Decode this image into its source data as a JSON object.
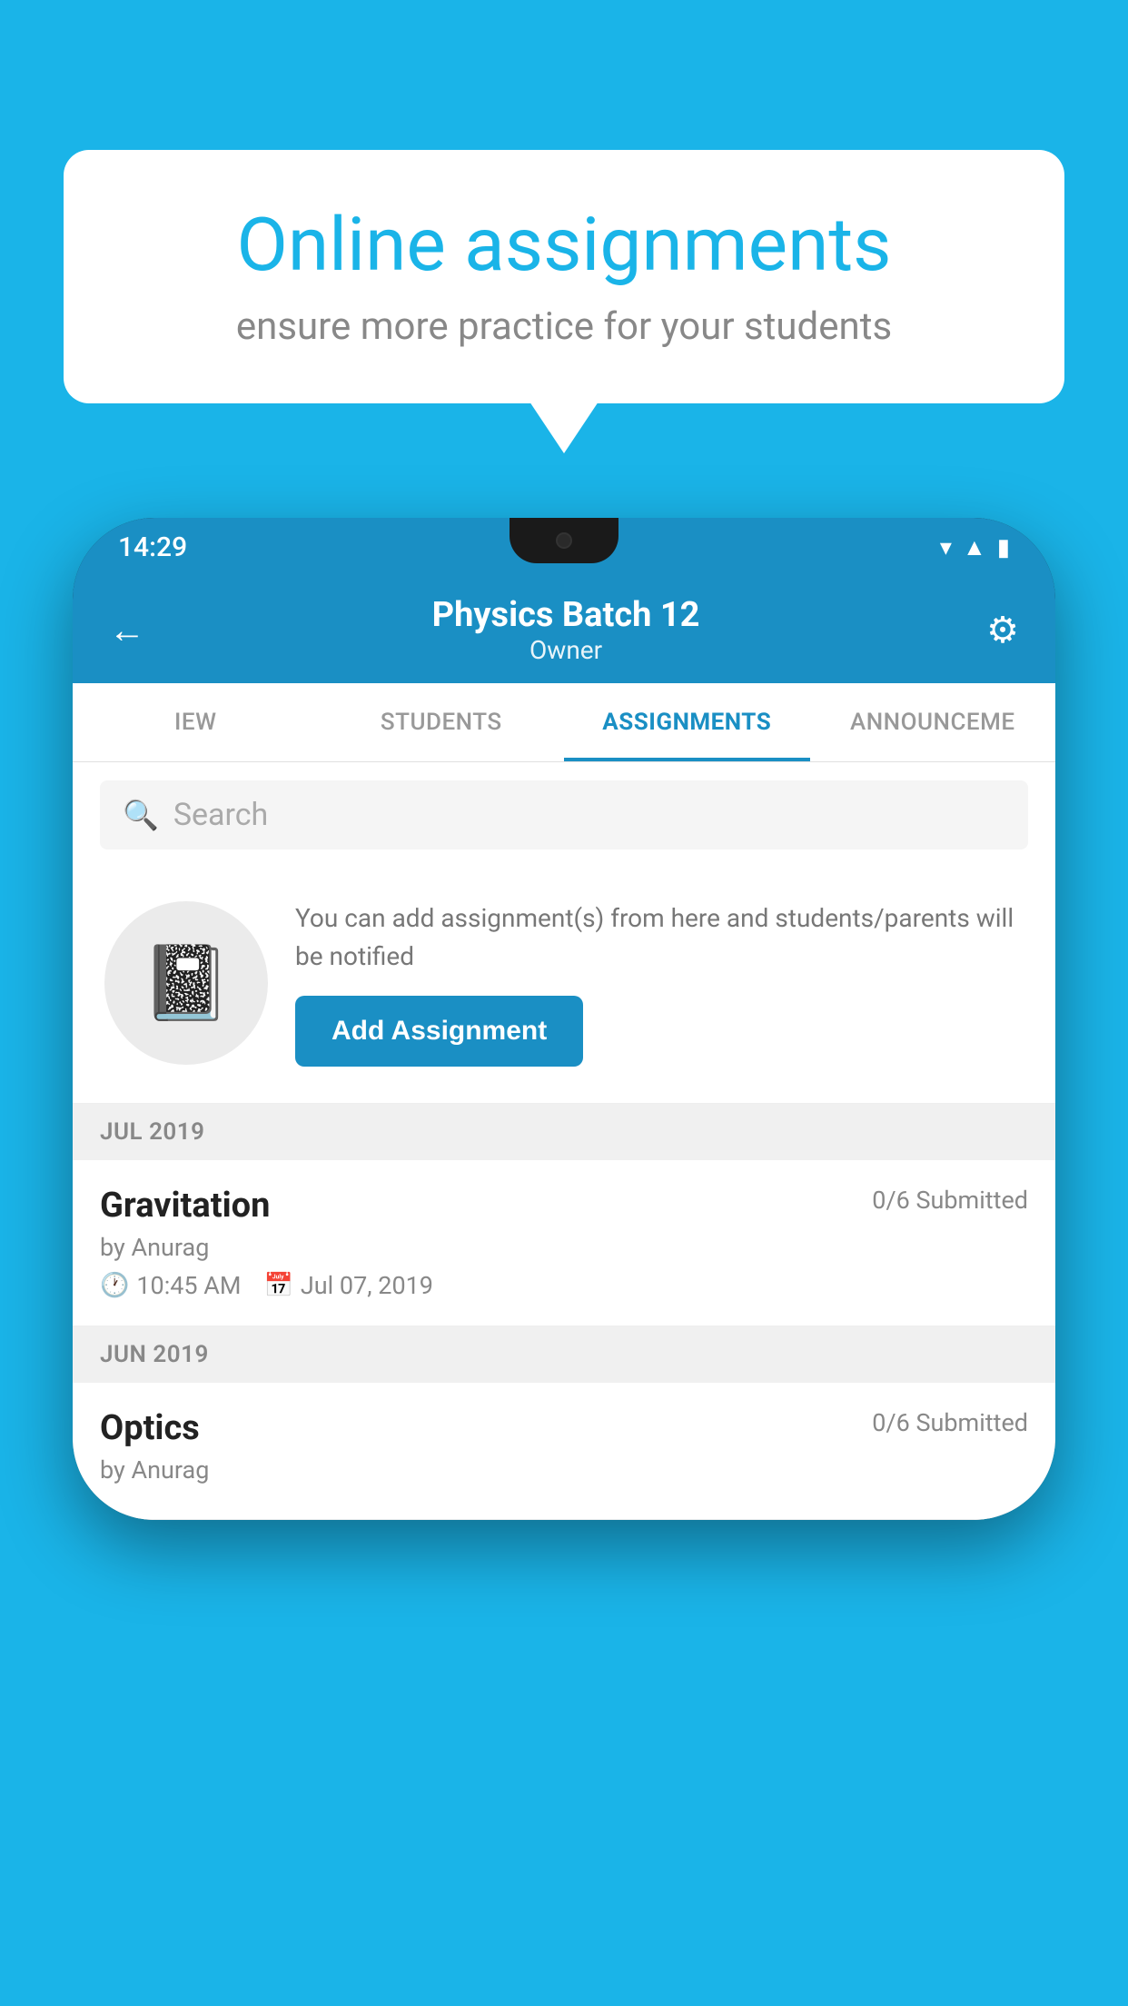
{
  "background_color": "#1ab4e8",
  "speech_bubble": {
    "title": "Online assignments",
    "subtitle": "ensure more practice for your students"
  },
  "phone": {
    "status_bar": {
      "time": "14:29"
    },
    "header": {
      "title": "Physics Batch 12",
      "subtitle": "Owner",
      "back_label": "←",
      "settings_label": "⚙"
    },
    "tabs": [
      {
        "label": "IEW",
        "active": false
      },
      {
        "label": "STUDENTS",
        "active": false
      },
      {
        "label": "ASSIGNMENTS",
        "active": true
      },
      {
        "label": "ANNOUNCEM",
        "active": false
      }
    ],
    "search": {
      "placeholder": "Search"
    },
    "cta": {
      "description": "You can add assignment(s) from here and students/parents will be notified",
      "button_label": "Add Assignment"
    },
    "sections": [
      {
        "label": "JUL 2019",
        "assignments": [
          {
            "name": "Gravitation",
            "submitted": "0/6 Submitted",
            "by": "by Anurag",
            "time": "10:45 AM",
            "date": "Jul 07, 2019"
          }
        ]
      },
      {
        "label": "JUN 2019",
        "assignments": [
          {
            "name": "Optics",
            "submitted": "0/6 Submitted",
            "by": "by Anurag",
            "time": "",
            "date": ""
          }
        ]
      }
    ]
  }
}
